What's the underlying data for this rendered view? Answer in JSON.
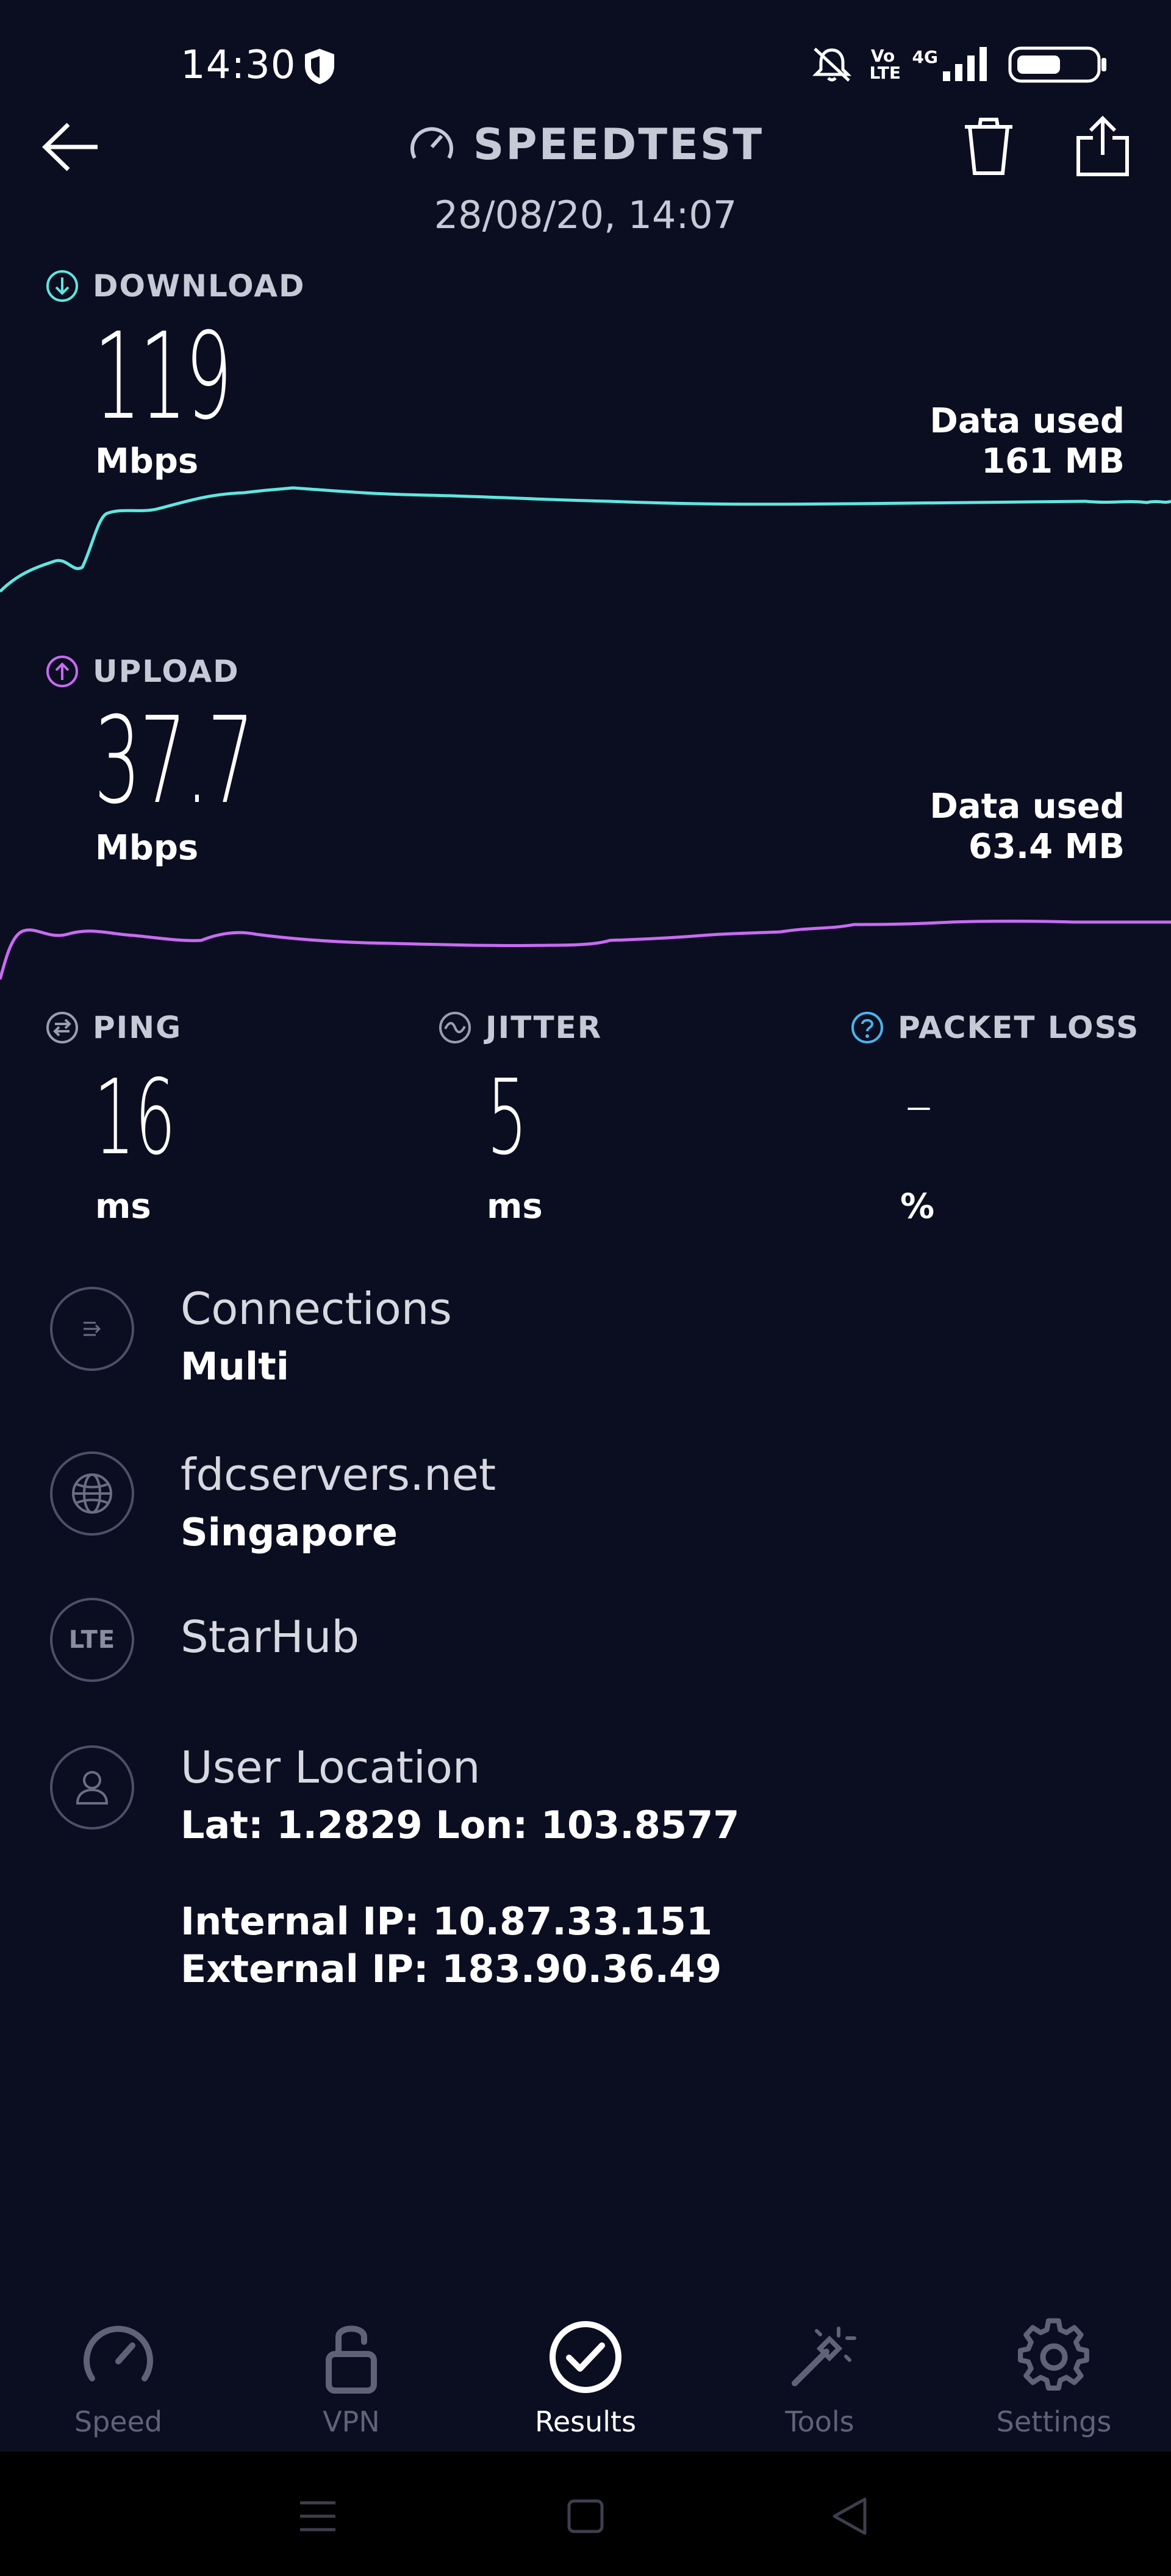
{
  "status_bar": {
    "time": "14:30",
    "icons": [
      "shield-icon",
      "mute-icon",
      "volte-icon",
      "4g-signal-icon",
      "battery-icon"
    ],
    "network_volte": "Vo LTE",
    "network_4g": "4G"
  },
  "header": {
    "title": "SPEEDTEST",
    "date": "28/08/20, 14:07"
  },
  "download": {
    "label": "DOWNLOAD",
    "value": "119",
    "unit": "Mbps",
    "data_used_label": "Data used",
    "data_used_value": "161 MB",
    "color": "#5fe6df"
  },
  "upload": {
    "label": "UPLOAD",
    "value": "37.7",
    "unit": "Mbps",
    "data_used_label": "Data used",
    "data_used_value": "63.4 MB",
    "color": "#c76bf2"
  },
  "metrics": {
    "ping": {
      "label": "PING",
      "value": "16",
      "unit": "ms"
    },
    "jitter": {
      "label": "JITTER",
      "value": "5",
      "unit": "ms"
    },
    "packet_loss": {
      "label": "PACKET LOSS",
      "value": "–",
      "unit": "%"
    }
  },
  "info": {
    "connections": {
      "title": "Connections",
      "value": "Multi"
    },
    "server": {
      "title": "fdcservers.net",
      "value": "Singapore"
    },
    "provider": {
      "badge": "LTE",
      "title": "StarHub"
    },
    "user_location": {
      "title": "User Location",
      "coords": "Lat: 1.2829 Lon: 103.8577",
      "internal_ip": "Internal IP: 10.87.33.151",
      "external_ip": "External IP: 183.90.36.49"
    }
  },
  "nav": {
    "items": [
      {
        "label": "Speed",
        "icon": "speed-gauge-icon"
      },
      {
        "label": "VPN",
        "icon": "unlock-icon"
      },
      {
        "label": "Results",
        "icon": "check-circle-icon",
        "active": true
      },
      {
        "label": "Tools",
        "icon": "magic-wand-icon"
      },
      {
        "label": "Settings",
        "icon": "gear-icon"
      }
    ]
  }
}
